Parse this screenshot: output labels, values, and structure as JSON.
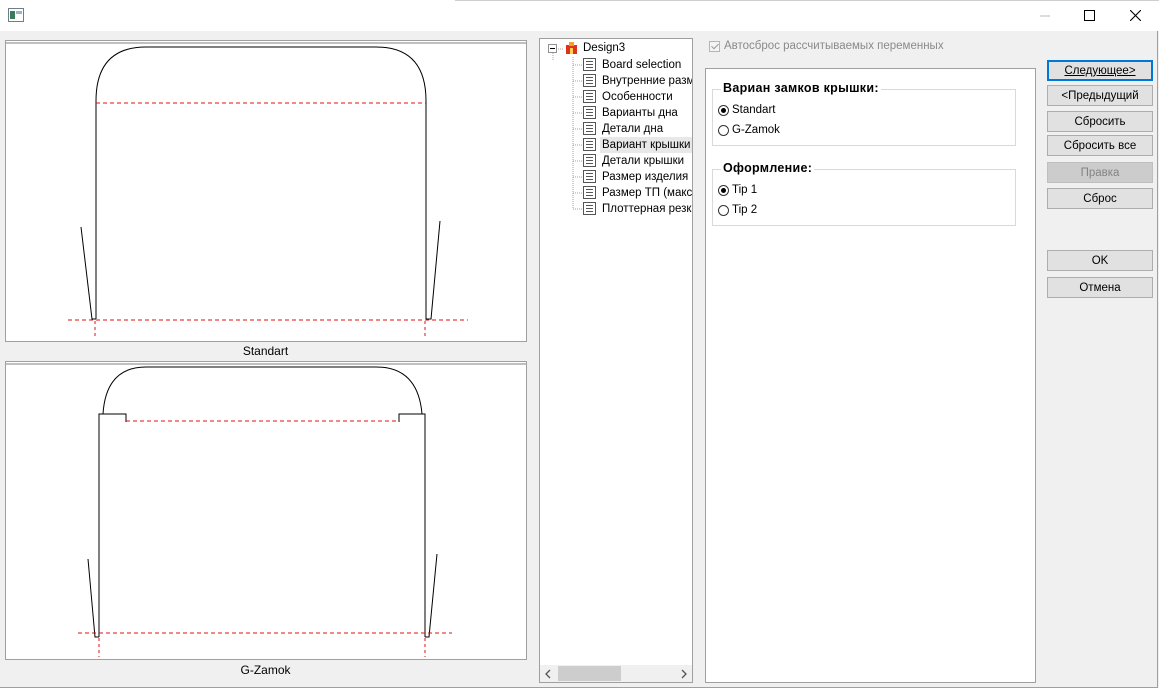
{
  "window": {
    "icon": "app-window-icon"
  },
  "previews": [
    {
      "label": "Standart"
    },
    {
      "label": "G-Zamok"
    }
  ],
  "tree": {
    "root": "Design3",
    "items": [
      "Board selection",
      "Внутренние разме",
      "Особенности",
      "Варианты дна",
      "Детали дна",
      "Вариант крышки",
      "Детали крышки",
      "Размер изделия",
      "Размер ТП (макс Г",
      "Плоттерная резка"
    ],
    "selected_index": 5
  },
  "autoreset": {
    "label": "Автосброс рассчитываемых переменных",
    "checked": true
  },
  "groups": {
    "lock": {
      "title": "Вариан замков крышки:",
      "options": [
        "Standart",
        "G-Zamok"
      ],
      "selected": 0
    },
    "design": {
      "title": "Оформление:",
      "options": [
        "Tip 1",
        "Tip 2"
      ],
      "selected": 0
    }
  },
  "buttons": {
    "next": "Следующее>",
    "prev": "<Предыдущий",
    "reset": "Сбросить",
    "reset_all": "Сбросить все",
    "edit": "Правка",
    "clear": "Сброс",
    "ok": "OK",
    "cancel": "Отмена"
  }
}
